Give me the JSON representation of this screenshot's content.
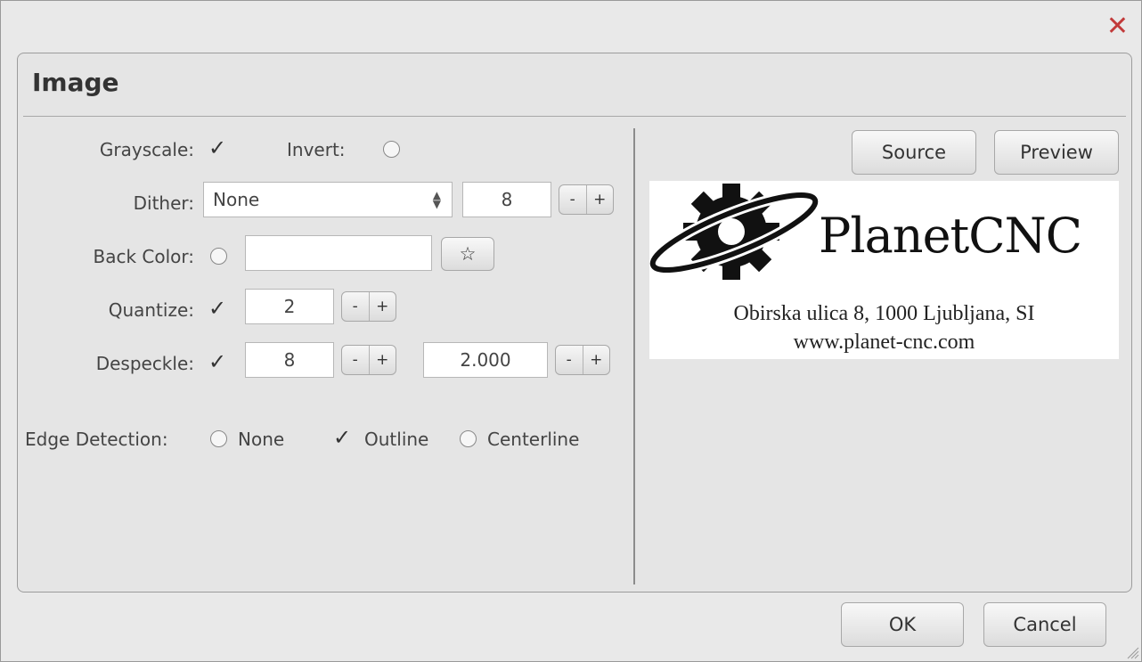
{
  "dialog": {
    "close_label": "✕"
  },
  "panel": {
    "title": "Image"
  },
  "grayscale": {
    "label": "Grayscale:",
    "checked": true
  },
  "invert": {
    "label": "Invert:",
    "checked": false
  },
  "dither": {
    "label": "Dither:",
    "selected": "None",
    "value": "8"
  },
  "back_color": {
    "label": "Back Color:",
    "value": ""
  },
  "quantize": {
    "label": "Quantize:",
    "value": "2"
  },
  "despeckle": {
    "label": "Despeckle:",
    "value1": "8",
    "value2": "2.000"
  },
  "edge_detection": {
    "label": "Edge Detection:",
    "options": [
      "None",
      "Outline",
      "Centerline"
    ],
    "selected": "Outline"
  },
  "stepper": {
    "minus": "-",
    "plus": "+"
  },
  "star_glyph": "☆",
  "check_glyph": "✓",
  "view_buttons": {
    "source": "Source",
    "preview": "Preview"
  },
  "preview_image": {
    "logo_text": "PlanetCNC",
    "address_line": "Obirska ulica 8, 1000 Ljubljana, SI",
    "website": "www.planet-cnc.com"
  },
  "footer": {
    "ok": "OK",
    "cancel": "Cancel"
  }
}
